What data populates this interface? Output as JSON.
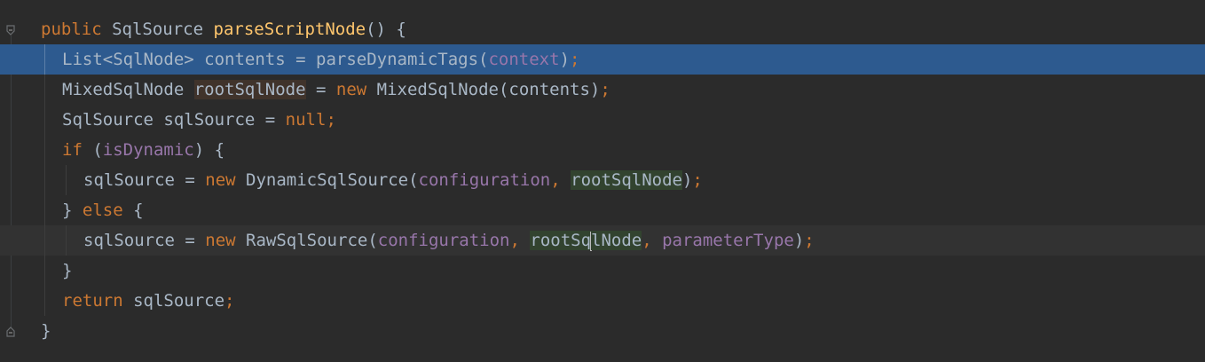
{
  "editor": {
    "lines": [
      {
        "indent": 0,
        "tokens": [
          {
            "t": "public",
            "c": "kw"
          },
          {
            "t": " ",
            "c": "id"
          },
          {
            "t": "SqlSource",
            "c": "id"
          },
          {
            "t": " ",
            "c": "id"
          },
          {
            "t": "parseScriptNode",
            "c": "fn"
          },
          {
            "t": "() {",
            "c": "punc"
          }
        ]
      },
      {
        "indent": 1,
        "selected": true,
        "tokens": [
          {
            "t": "List<SqlNode>",
            "c": "id"
          },
          {
            "t": " contents = ",
            "c": "id"
          },
          {
            "t": "parseDynamicTags",
            "c": "id"
          },
          {
            "t": "(",
            "c": "punc"
          },
          {
            "t": "context",
            "c": "fld"
          },
          {
            "t": ")",
            "c": "punc"
          },
          {
            "t": ";",
            "c": "semi"
          }
        ]
      },
      {
        "indent": 1,
        "tokens": [
          {
            "t": "MixedSqlNode",
            "c": "id"
          },
          {
            "t": " ",
            "c": "id"
          },
          {
            "t": "rootSqlNode",
            "c": "id",
            "hl": "write"
          },
          {
            "t": " = ",
            "c": "id"
          },
          {
            "t": "new",
            "c": "kw"
          },
          {
            "t": " MixedSqlNode(contents)",
            "c": "id"
          },
          {
            "t": ";",
            "c": "semi"
          }
        ]
      },
      {
        "indent": 1,
        "tokens": [
          {
            "t": "SqlSource sqlSource = ",
            "c": "id"
          },
          {
            "t": "null",
            "c": "kw"
          },
          {
            "t": ";",
            "c": "semi"
          }
        ]
      },
      {
        "indent": 1,
        "tokens": [
          {
            "t": "if",
            "c": "kw"
          },
          {
            "t": " (",
            "c": "punc"
          },
          {
            "t": "isDynamic",
            "c": "fld"
          },
          {
            "t": ") {",
            "c": "punc"
          }
        ]
      },
      {
        "indent": 2,
        "tokens": [
          {
            "t": "sqlSource = ",
            "c": "id"
          },
          {
            "t": "new",
            "c": "kw"
          },
          {
            "t": " DynamicSqlSource(",
            "c": "id"
          },
          {
            "t": "configuration",
            "c": "fld"
          },
          {
            "t": ", ",
            "c": "semi"
          },
          {
            "t": "rootSqlNode",
            "c": "id",
            "hl": "read"
          },
          {
            "t": ")",
            "c": "punc"
          },
          {
            "t": ";",
            "c": "semi"
          }
        ]
      },
      {
        "indent": 1,
        "tokens": [
          {
            "t": "} ",
            "c": "punc"
          },
          {
            "t": "else",
            "c": "kw"
          },
          {
            "t": " {",
            "c": "punc"
          }
        ]
      },
      {
        "indent": 2,
        "caret_row": true,
        "tokens": [
          {
            "t": "sqlSource = ",
            "c": "id"
          },
          {
            "t": "new",
            "c": "kw"
          },
          {
            "t": " RawSqlSource(",
            "c": "id"
          },
          {
            "t": "configuration",
            "c": "fld"
          },
          {
            "t": ", ",
            "c": "semi"
          },
          {
            "t": "rootSq",
            "c": "id",
            "hl": "read"
          },
          {
            "caret": true
          },
          {
            "t": "lNode",
            "c": "id",
            "hl": "read"
          },
          {
            "t": ", ",
            "c": "semi"
          },
          {
            "t": "parameterType",
            "c": "fld"
          },
          {
            "t": ")",
            "c": "punc"
          },
          {
            "t": ";",
            "c": "semi"
          }
        ]
      },
      {
        "indent": 1,
        "tokens": [
          {
            "t": "}",
            "c": "punc"
          }
        ]
      },
      {
        "indent": 1,
        "tokens": [
          {
            "t": "return",
            "c": "kw"
          },
          {
            "t": " sqlSource",
            "c": "id"
          },
          {
            "t": ";",
            "c": "semi"
          }
        ]
      },
      {
        "indent": 0,
        "tokens": [
          {
            "t": "}",
            "c": "punc"
          }
        ]
      }
    ]
  },
  "gutter": {
    "fold_icons": [
      "fold-collapse-icon",
      "fold-end-icon"
    ]
  }
}
